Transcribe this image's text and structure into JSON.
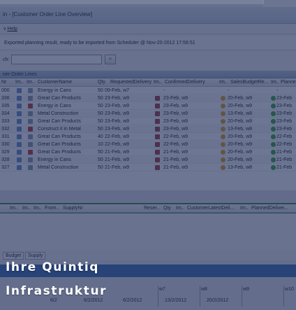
{
  "window": {
    "title": "in - [Customer Order Line Overview]"
  },
  "menu": {
    "items": [
      "Help"
    ]
  },
  "status": {
    "message": "Exported planning result, ready to be imported from Scheduler @ Nov-20-2012 17:56:51"
  },
  "search": {
    "label": "ch:",
    "value": "",
    "button_label": "≈"
  },
  "section": {
    "title": "ner Order Lines"
  },
  "table": {
    "columns": [
      "Nr",
      "Im..",
      "Im..",
      "CustomerName",
      "Qty",
      "RequestedDelivery",
      "Im..",
      "ConfirmedDelivery",
      "Im..",
      "SalesBudgetRe...",
      "Im..",
      "Planne"
    ],
    "rows": [
      {
        "nr": "000",
        "customer": "Energy in Cans",
        "qty": "50",
        "requested": "09-Feb, w7",
        "confirmed": "-",
        "budget": "-",
        "planned": "-",
        "status": "none"
      },
      {
        "nr": "336",
        "customer": "Great Can Products",
        "qty": "50",
        "requested": "23-Feb, w9",
        "confirmed": "23-Feb, w9",
        "budget": "20-Feb, w9",
        "planned": "23-Feb",
        "status": "green"
      },
      {
        "nr": "335",
        "customer": "Energy in Cans",
        "qty": "50",
        "requested": "23-Feb, w9",
        "confirmed": "23-Feb, w9",
        "budget": "20-Feb, w9",
        "planned": "23-Feb",
        "status": "green"
      },
      {
        "nr": "334",
        "customer": "Metal Construction",
        "qty": "50",
        "requested": "23-Feb, w9",
        "confirmed": "23-Feb, w9",
        "budget": "13-Feb, w8",
        "planned": "23-Feb",
        "status": "green"
      },
      {
        "nr": "333",
        "customer": "Great Can Products",
        "qty": "50",
        "requested": "23-Feb, w9",
        "confirmed": "23-Feb, w9",
        "budget": "20-Feb, w9",
        "planned": "23-Feb",
        "status": "green"
      },
      {
        "nr": "332",
        "customer": "Construct it in Metal",
        "qty": "50",
        "requested": "23-Feb, w9",
        "confirmed": "23-Feb, w9",
        "budget": "13-Feb, w8",
        "planned": "23-Feb",
        "status": "green"
      },
      {
        "nr": "331",
        "customer": "Great Can Products",
        "qty": "40",
        "requested": "22-Feb, w9",
        "confirmed": "22-Feb, w9",
        "budget": "20-Feb, w9",
        "planned": "22-Feb",
        "status": "green"
      },
      {
        "nr": "330",
        "customer": "Great Can Products",
        "qty": "10",
        "requested": "22-Feb, w9",
        "confirmed": "22-Feb, w9",
        "budget": "20-Feb, w9",
        "planned": "22-Feb",
        "status": "green"
      },
      {
        "nr": "329",
        "customer": "Great Can Products",
        "qty": "50",
        "requested": "21-Feb, w9",
        "confirmed": "21-Feb, w9",
        "budget": "20-Feb, w9",
        "planned": "21-Feb",
        "status": "green"
      },
      {
        "nr": "328",
        "customer": "Energy in Cans",
        "qty": "50",
        "requested": "21-Feb, w9",
        "confirmed": "21-Feb, w9",
        "budget": "20-Feb, w9",
        "planned": "21-Feb",
        "status": "green"
      },
      {
        "nr": "327",
        "customer": "Metal Construction",
        "qty": "50",
        "requested": "21-Feb, w9",
        "confirmed": "21-Feb, w9",
        "budget": "13-Feb, w8",
        "planned": "21-Feb",
        "status": "green"
      }
    ]
  },
  "sub_table": {
    "columns": [
      "Im..",
      "Im..",
      "Im..",
      "From..",
      "SupplyNr",
      "Reser..",
      "Qty",
      "Im..",
      "CustomerLatestDeli...",
      "Im..",
      "PlannedDeliver..."
    ]
  },
  "tabs": [
    "Budget",
    "Supply"
  ],
  "gantt": {
    "weeks": [
      "w7",
      "w8",
      "w9",
      "w10"
    ],
    "dates": [
      "6/2",
      "6/2/2012",
      "6/2/2012",
      "13/2/2012",
      "20/2/2012"
    ]
  },
  "headline": {
    "line1": "Ihre Quintiq",
    "line2": "Infrastruktur"
  },
  "colors": {
    "overlay": "#1a2854",
    "accent": "#3f73b4",
    "status_green": "#3aa63f",
    "status_orange": "#e0a12a"
  }
}
